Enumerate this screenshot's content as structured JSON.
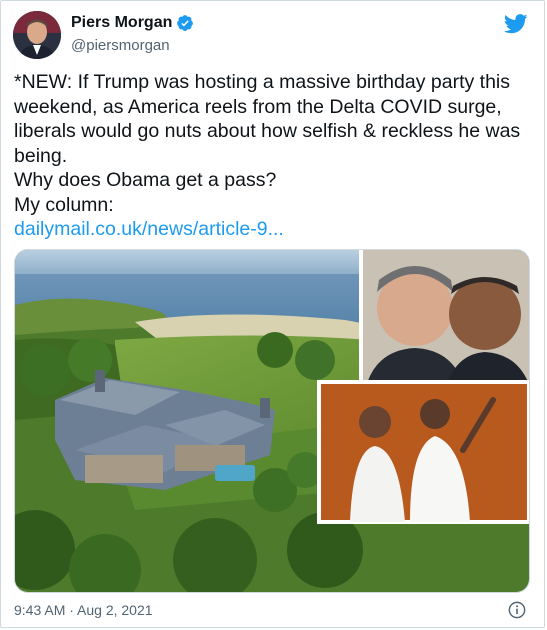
{
  "author": {
    "name": "Piers Morgan",
    "handle": "@piersmorgan",
    "verified": true,
    "avatar_icon": "avatar-photo"
  },
  "tweet": {
    "text": "*NEW: If Trump was hosting a massive birthday party this weekend, as America reels from the Delta COVID surge, liberals would go nuts about how selfish & reckless he was being.\nWhy does Obama get a pass?\nMy column:",
    "link": "dailymail.co.uk/news/article-9..."
  },
  "footer": {
    "timestamp": "9:43 AM · Aug 2, 2021"
  },
  "icons": {
    "brand": "twitter-bird-icon",
    "verified": "verified-badge-icon",
    "info": "info-icon"
  },
  "colors": {
    "brand": "#1d9bf0",
    "text": "#0f1419",
    "muted": "#536471",
    "border": "#cfd9de"
  }
}
